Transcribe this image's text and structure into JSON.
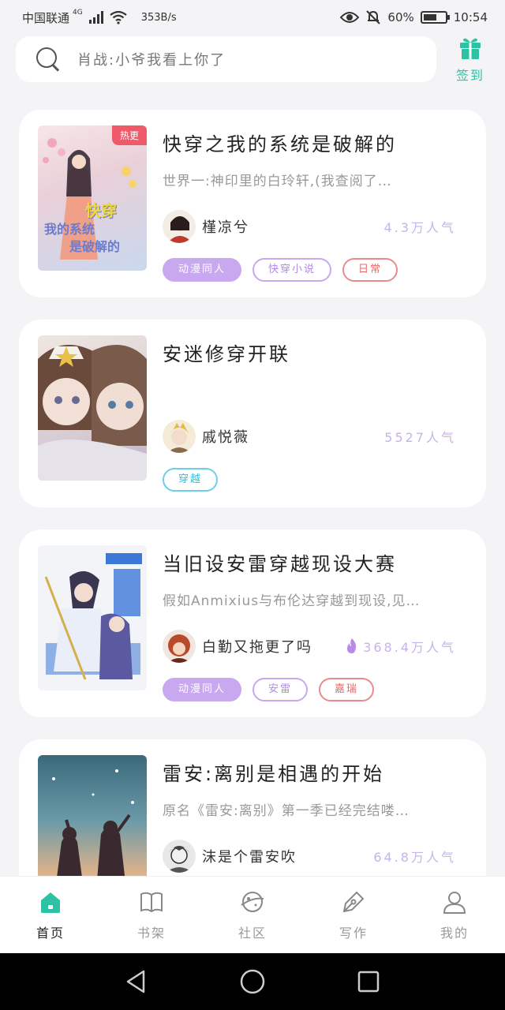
{
  "status_bar": {
    "carrier": "中国联通",
    "network": "4G",
    "speed": "353B/s",
    "battery": "60%",
    "time": "10:54"
  },
  "search": {
    "placeholder": "肖战:小爷我看上你了"
  },
  "checkin": {
    "label": "签到"
  },
  "books": [
    {
      "badge": "热更",
      "cover_text": [
        "快穿",
        "我的系统",
        "是破解的"
      ],
      "title": "快穿之我的系统是破解的",
      "description": "世界一:神印里的白玲轩,(我查阅了…",
      "author": "槿凉兮",
      "popularity": "4.3万人气",
      "tags": [
        "动漫同人",
        "快穿小说",
        "日常"
      ]
    },
    {
      "title": "安迷修穿开联",
      "description": "",
      "author": "戚悦薇",
      "popularity": "5527人气",
      "tags": [
        "穿越"
      ]
    },
    {
      "title": "当旧设安雷穿越现设大赛",
      "description": "假如Anmixius与布伦达穿越到现设,见…",
      "author": "白勤又拖更了吗",
      "popularity": "368.4万人气",
      "tags": [
        "动漫同人",
        "安雷",
        "嘉瑞"
      ]
    },
    {
      "title": "雷安:离别是相遇的开始",
      "description": "原名《雷安:离别》第一季已经完结喽…",
      "author": "沫是个雷安吹",
      "popularity": "64.8万人气",
      "tags": []
    }
  ],
  "nav": {
    "home": "首页",
    "shelf": "书架",
    "community": "社区",
    "write": "写作",
    "mine": "我的"
  },
  "colors": {
    "accent": "#2ec2a5",
    "popularity": "#c7b3ec",
    "tag_purple": "#c8a8ef",
    "tag_red": "#ea8b8b",
    "tag_teal": "#6ccfe4"
  }
}
